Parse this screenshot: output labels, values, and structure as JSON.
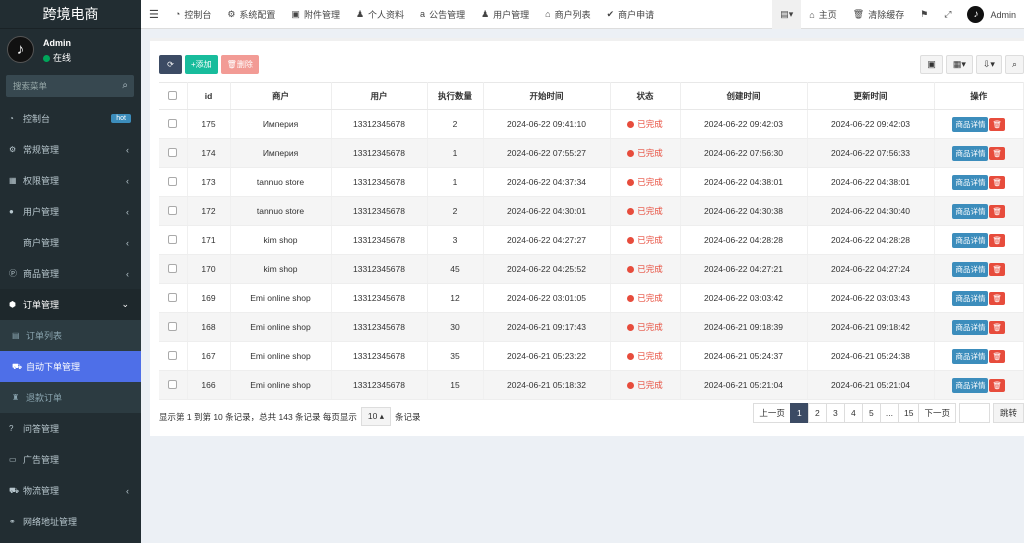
{
  "sidebar": {
    "logo": "跨境电商",
    "user_name": "Admin",
    "user_status": "在线",
    "search_placeholder": "搜索菜单",
    "items": [
      {
        "label": "控制台",
        "icon": "dashboard-icon",
        "badge": "hot"
      },
      {
        "label": "常规管理",
        "icon": "cogs-icon"
      },
      {
        "label": "权限管理",
        "icon": "group-icon"
      },
      {
        "label": "用户管理",
        "icon": "user-circle-icon"
      },
      {
        "label": "商户管理",
        "icon": "apple-icon"
      },
      {
        "label": "商品管理",
        "icon": "product-icon"
      },
      {
        "label": "订单管理",
        "icon": "cube-icon"
      },
      {
        "label": "订单列表",
        "icon": "list-icon"
      },
      {
        "label": "自动下单管理",
        "icon": "car-icon"
      },
      {
        "label": "退款订单",
        "icon": "refund-icon"
      },
      {
        "label": "问答管理",
        "icon": "question-icon"
      },
      {
        "label": "广告管理",
        "icon": "ad-icon"
      },
      {
        "label": "物流管理",
        "icon": "truck-icon"
      },
      {
        "label": "网络地址管理",
        "icon": "link-icon"
      }
    ]
  },
  "topbar": {
    "items": [
      {
        "label": "控制台",
        "icon": "dashboard-icon"
      },
      {
        "label": "系统配置",
        "icon": "cogs-icon"
      },
      {
        "label": "附件管理",
        "icon": "folder-icon"
      },
      {
        "label": "个人资料",
        "icon": "user-icon"
      },
      {
        "label": "公告管理",
        "icon": "amazon-icon"
      },
      {
        "label": "用户管理",
        "icon": "user-icon"
      },
      {
        "label": "商户列表",
        "icon": "home-icon"
      },
      {
        "label": "商户申请",
        "icon": "check-circle-icon"
      }
    ],
    "home": "主页",
    "clear_cache": "清除缓存",
    "admin": "Admin"
  },
  "toolbar": {
    "add": "添加",
    "delete": "删除"
  },
  "table": {
    "headers": [
      "id",
      "商户",
      "用户",
      "执行数量",
      "开始时间",
      "状态",
      "创建时间",
      "更新时间",
      "操作"
    ],
    "status_text": "已完成",
    "detail_label": "商品详情",
    "rows": [
      {
        "id": "175",
        "merchant": "Империя",
        "user": "13312345678",
        "count": "2",
        "start": "2024-06-22 09:41:10",
        "created": "2024-06-22 09:42:03",
        "updated": "2024-06-22 09:42:03"
      },
      {
        "id": "174",
        "merchant": "Империя",
        "user": "13312345678",
        "count": "1",
        "start": "2024-06-22 07:55:27",
        "created": "2024-06-22 07:56:30",
        "updated": "2024-06-22 07:56:33"
      },
      {
        "id": "173",
        "merchant": "tannuo store",
        "user": "13312345678",
        "count": "1",
        "start": "2024-06-22 04:37:34",
        "created": "2024-06-22 04:38:01",
        "updated": "2024-06-22 04:38:01"
      },
      {
        "id": "172",
        "merchant": "tannuo store",
        "user": "13312345678",
        "count": "2",
        "start": "2024-06-22 04:30:01",
        "created": "2024-06-22 04:30:38",
        "updated": "2024-06-22 04:30:40"
      },
      {
        "id": "171",
        "merchant": "kim shop",
        "user": "13312345678",
        "count": "3",
        "start": "2024-06-22 04:27:27",
        "created": "2024-06-22 04:28:28",
        "updated": "2024-06-22 04:28:28"
      },
      {
        "id": "170",
        "merchant": "kim shop",
        "user": "13312345678",
        "count": "45",
        "start": "2024-06-22 04:25:52",
        "created": "2024-06-22 04:27:21",
        "updated": "2024-06-22 04:27:24"
      },
      {
        "id": "169",
        "merchant": "Emi online shop",
        "user": "13312345678",
        "count": "12",
        "start": "2024-06-22 03:01:05",
        "created": "2024-06-22 03:03:42",
        "updated": "2024-06-22 03:03:43"
      },
      {
        "id": "168",
        "merchant": "Emi online shop",
        "user": "13312345678",
        "count": "30",
        "start": "2024-06-21 09:17:43",
        "created": "2024-06-21 09:18:39",
        "updated": "2024-06-21 09:18:42"
      },
      {
        "id": "167",
        "merchant": "Emi online shop",
        "user": "13312345678",
        "count": "35",
        "start": "2024-06-21 05:23:22",
        "created": "2024-06-21 05:24:37",
        "updated": "2024-06-21 05:24:38"
      },
      {
        "id": "166",
        "merchant": "Emi online shop",
        "user": "13312345678",
        "count": "15",
        "start": "2024-06-21 05:18:32",
        "created": "2024-06-21 05:21:04",
        "updated": "2024-06-21 05:21:04"
      }
    ]
  },
  "pager": {
    "info_prefix": "显示第 1 到第 10 条记录，总共 143 条记录 每页显示",
    "page_size": "10",
    "info_suffix": "条记录",
    "prev": "上一页",
    "pages": [
      "1",
      "2",
      "3",
      "4",
      "5",
      "...",
      "15"
    ],
    "next": "下一页",
    "go": "跳转"
  },
  "colors": {
    "sidebar": "#222d32",
    "accent": "#4e6fe8",
    "success": "#18bc9c",
    "danger": "#e74c3c",
    "primary": "#3c8dbc"
  }
}
